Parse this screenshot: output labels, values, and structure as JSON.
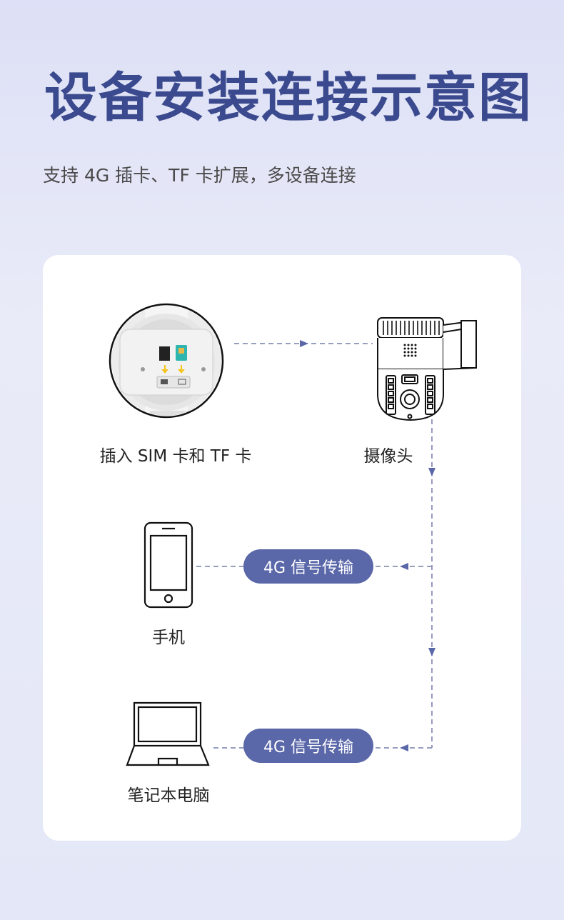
{
  "header": {
    "title": "设备安装连接示意图",
    "subtitle": "支持 4G 插卡、TF 卡扩展，多设备连接"
  },
  "diagram": {
    "nodes": {
      "sim": {
        "label": "插入 SIM 卡和 TF 卡",
        "icon": "sim-slot-icon"
      },
      "camera": {
        "label": "摄像头",
        "icon": "ptz-camera-icon"
      },
      "phone": {
        "label": "手机",
        "icon": "smartphone-icon"
      },
      "laptop": {
        "label": "笔记本电脑",
        "icon": "laptop-icon"
      }
    },
    "links": {
      "phone_link": "4G 信号传输",
      "laptop_link": "4G 信号传输"
    }
  },
  "colors": {
    "title": "#3b4a8e",
    "accent": "#5a67a8",
    "connector": "#8a90b8",
    "arrow": "#5a67a8"
  }
}
